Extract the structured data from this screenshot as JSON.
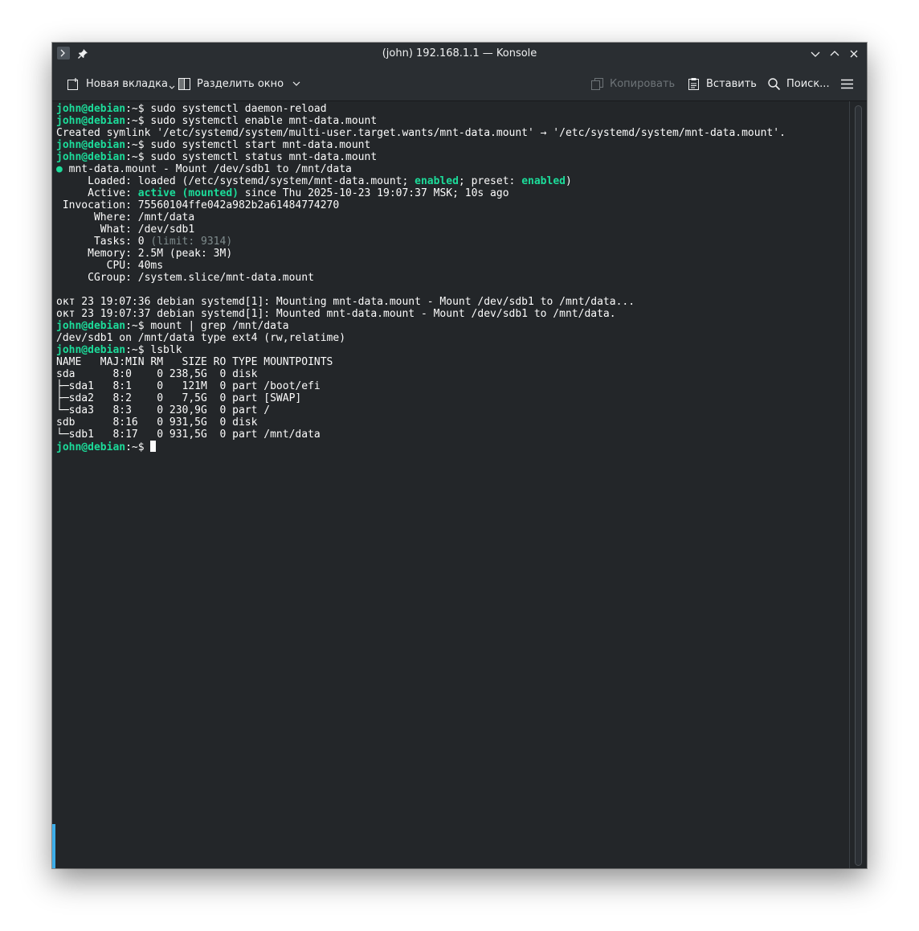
{
  "window": {
    "title": "(john) 192.168.1.1 — Konsole"
  },
  "toolbar": {
    "new_tab_label": "Новая вкладка",
    "split_label": "Разделить окно",
    "copy_label": "Копировать",
    "paste_label": "Вставить",
    "search_label": "Поиск..."
  },
  "prompt": {
    "userhost": "john@debian",
    "path": ":~",
    "symbol": "$ "
  },
  "commands": {
    "c1": "sudo systemctl daemon-reload",
    "c2": "sudo systemctl enable mnt-data.mount",
    "c3": "sudo systemctl start mnt-data.mount",
    "c4": "sudo systemctl status mnt-data.mount",
    "c5": "mount | grep /mnt/data",
    "c6": "lsblk"
  },
  "output": {
    "symlink": "Created symlink '/etc/systemd/system/multi-user.target.wants/mnt-data.mount' → '/etc/systemd/system/mnt-data.mount'.",
    "status_dot": "●",
    "status_unit": " mnt-data.mount - Mount /dev/sdb1 to /mnt/data",
    "loaded_a": "     Loaded: loaded (/etc/systemd/system/mnt-data.mount; ",
    "loaded_enabled": "enabled",
    "loaded_b": "; preset: ",
    "loaded_preset": "enabled",
    "loaded_c": ")",
    "active_a": "     Active: ",
    "active_state": "active (mounted)",
    "active_b": " since Thu 2025-10-23 19:07:37 MSK; 10s ago",
    "invocation": " Invocation: 75560104ffe042a982b2a61484774270",
    "where": "      Where: /mnt/data",
    "what": "       What: /dev/sdb1",
    "tasks_a": "      Tasks: 0 ",
    "tasks_limit": "(limit: 9314)",
    "memory": "     Memory: 2.5M (peak: 3M)",
    "cpu": "        CPU: 40ms",
    "cgroup": "     CGroup: /system.slice/mnt-data.mount",
    "log1": "окт 23 19:07:36 debian systemd[1]: Mounting mnt-data.mount - Mount /dev/sdb1 to /mnt/data...",
    "log2": "окт 23 19:07:37 debian systemd[1]: Mounted mnt-data.mount - Mount /dev/sdb1 to /mnt/data.",
    "mount_line": "/dev/sdb1 on /mnt/data type ext4 (rw,relatime)",
    "lsblk_header": "NAME   MAJ:MIN RM   SIZE RO TYPE MOUNTPOINTS",
    "lsblk_rows": [
      "sda      8:0    0 238,5G  0 disk",
      "├─sda1   8:1    0   121M  0 part /boot/efi",
      "├─sda2   8:2    0   7,5G  0 part [SWAP]",
      "└─sda3   8:3    0 230,9G  0 part /",
      "sdb      8:16   0 931,5G  0 disk",
      "└─sdb1   8:17   0 931,5G  0 part /mnt/data"
    ]
  }
}
